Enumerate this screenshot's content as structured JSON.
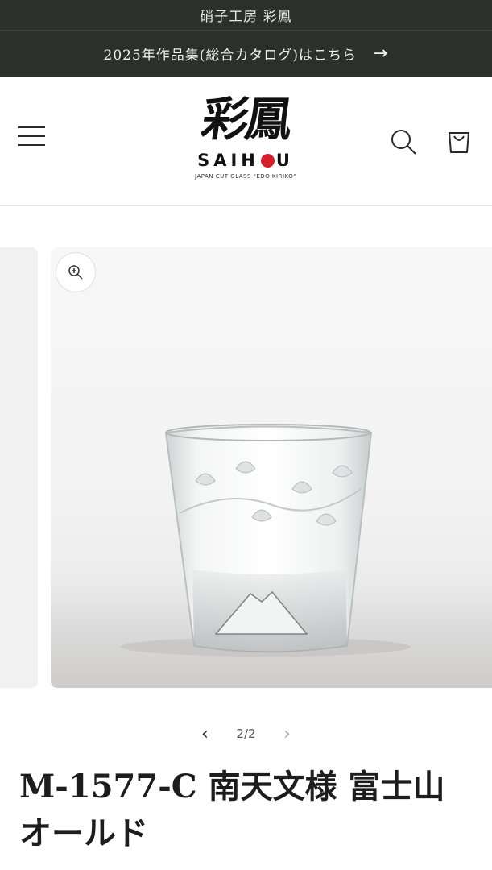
{
  "topbar": {
    "text": "硝子工房 彩鳳"
  },
  "announcement": {
    "text": "2025年作品集(総合カタログ)はこちら",
    "arrow_icon": "arrow-right-icon"
  },
  "header": {
    "menu_icon": "hamburger-menu-icon",
    "logo": {
      "kanji": "彩鳳",
      "latin_left": "SAIH",
      "latin_right": "U",
      "tagline": "JAPAN CUT GLASS \"EDO KIRIKO\"",
      "dot_color": "#d21f2b"
    },
    "search_icon": "search-icon",
    "cart_icon": "cart-icon"
  },
  "gallery": {
    "zoom_icon": "zoom-in-icon",
    "counter": "2/2",
    "prev_icon": "chevron-left-icon",
    "next_icon": "chevron-right-icon"
  },
  "product": {
    "title": "M-1577-C 南天文様 富士山オールド"
  },
  "colors": {
    "banner_bg": "#2b302c",
    "accent_red": "#d21f2b"
  }
}
